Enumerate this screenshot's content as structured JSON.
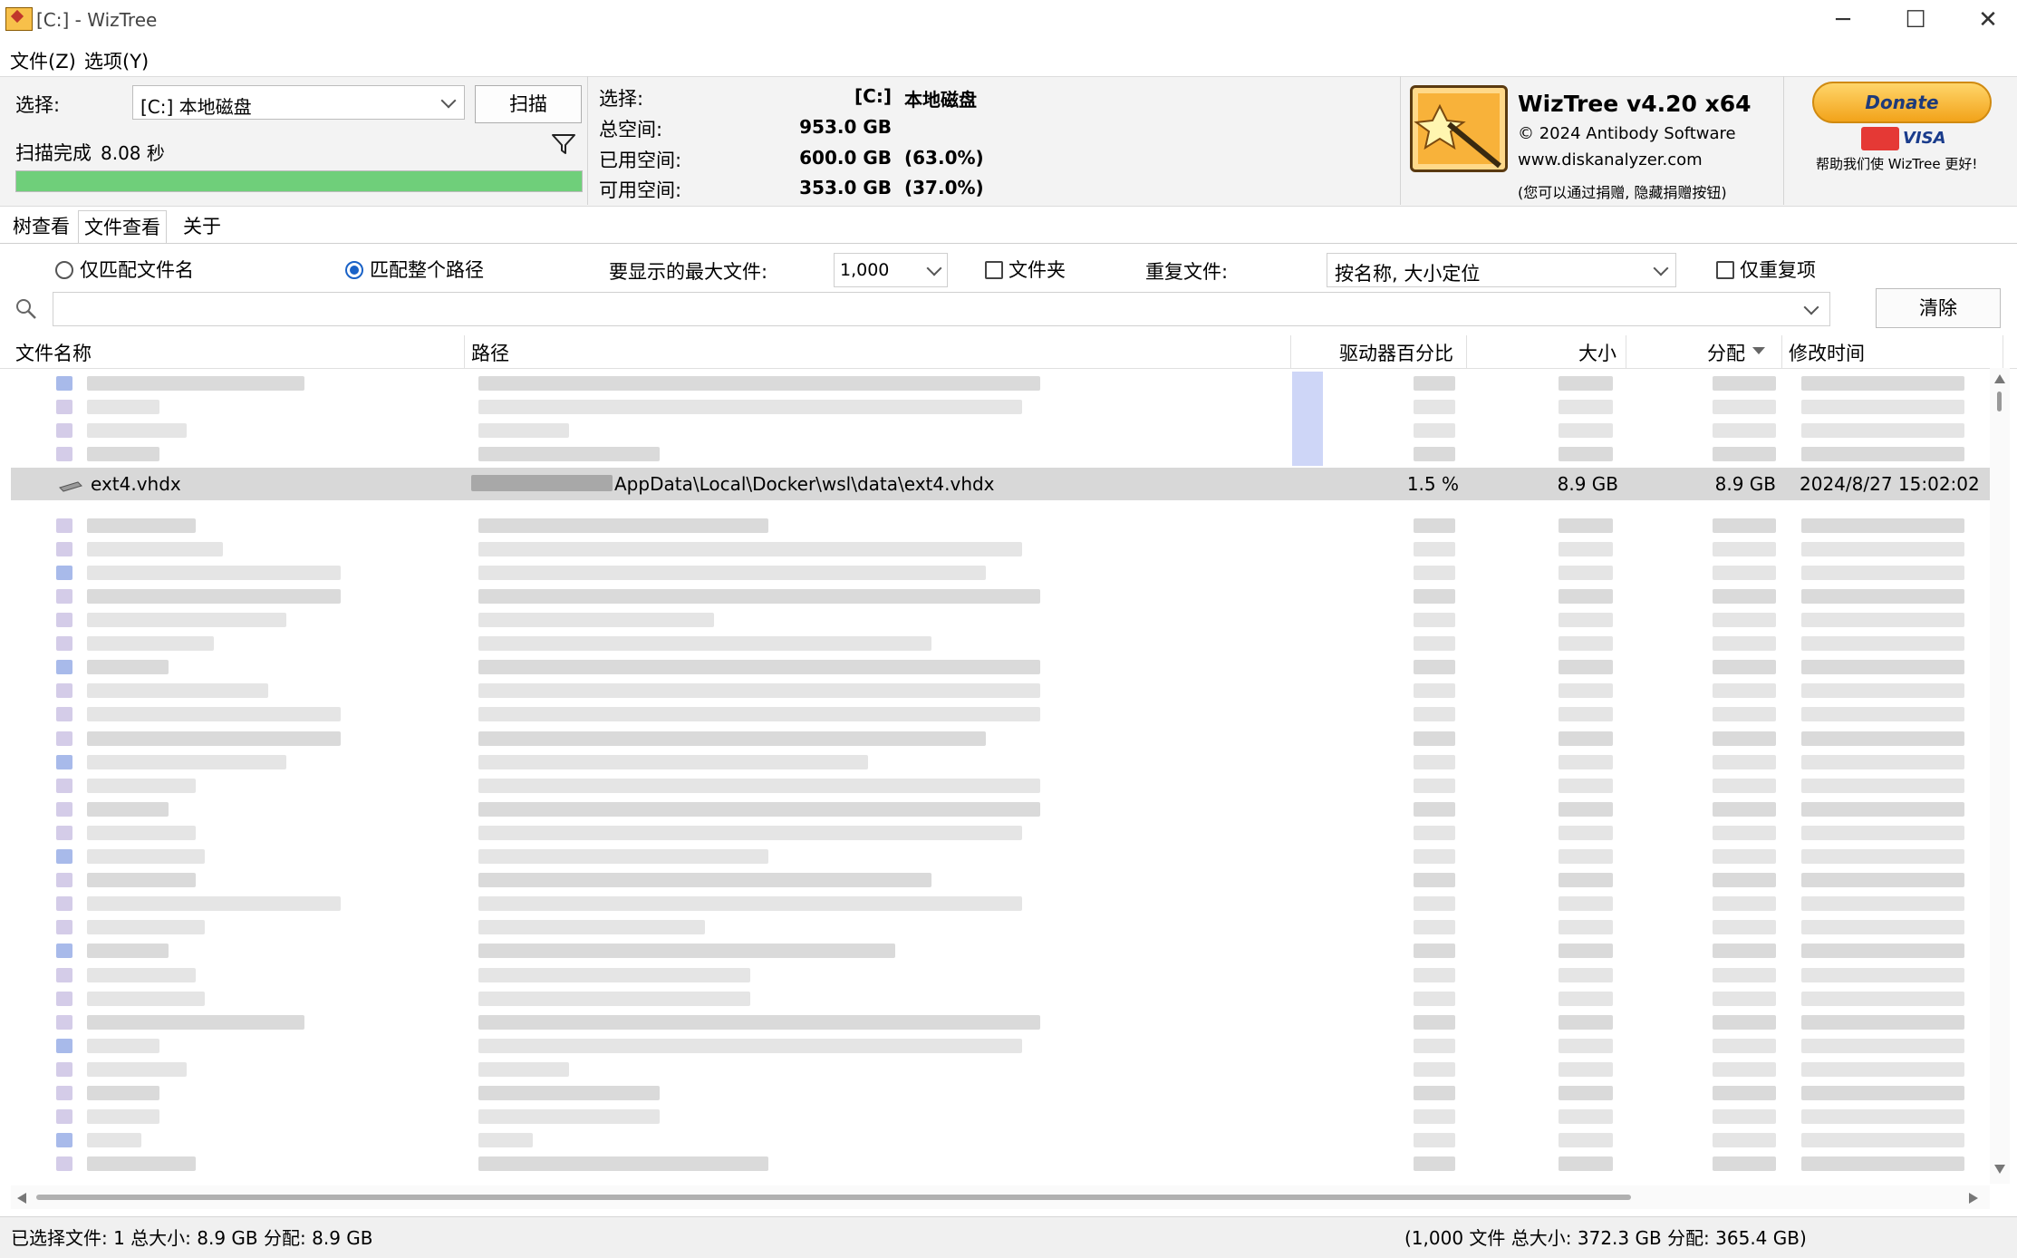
{
  "window": {
    "title": "[C:]  - WizTree",
    "minimize": "─",
    "maximize": "☐",
    "close": "✕"
  },
  "menu": [
    "文件(Z)",
    "选项(Y)"
  ],
  "scan": {
    "select_label": "选择:",
    "drive_value": "[C:] 本地磁盘",
    "scan_button": "扫描",
    "status_label": "扫描完成",
    "status_time": "8.08 秒",
    "progress": 1.0
  },
  "disk_info": {
    "select_label": "选择:",
    "select_drive": "[C:]",
    "select_name": "本地磁盘",
    "total_label": "总空间:",
    "total_value": "953.0 GB",
    "used_label": "已用空间:",
    "used_value": "600.0 GB",
    "used_pct": "(63.0%)",
    "free_label": "可用空间:",
    "free_value": "353.0 GB",
    "free_pct": "(37.0%)"
  },
  "about": {
    "product": "WizTree v4.20 x64",
    "copyright": "© 2024 Antibody Software",
    "website": "www.diskanalyzer.com",
    "note": "(您可以通过捐赠, 隐藏捐赠按钮)",
    "donate": "Donate",
    "visa": "VISA",
    "help": "帮助我们使 WizTree 更好!"
  },
  "tabs": [
    "树查看",
    "文件查看",
    "关于"
  ],
  "active_tab": "文件查看",
  "filters": {
    "match_name": "仅匹配文件名",
    "match_path": "匹配整个路径",
    "max_files_label": "要显示的最大文件:",
    "max_files_value": "1,000",
    "folders_label": "文件夹",
    "dup_label": "重复文件:",
    "dup_value": "按名称, 大小定位",
    "dup_only_label": "仅重复项",
    "clear_button": "清除"
  },
  "columns": [
    "文件名称",
    "路径",
    "驱动器百分比",
    "大小",
    "分配",
    "修改时间"
  ],
  "selected_row": {
    "name": "ext4.vhdx",
    "path": "AppData\\Local\\Docker\\wsl\\data\\ext4.vhdx",
    "percent": "1.5 %",
    "size": "8.9 GB",
    "allocated": "8.9 GB",
    "modified": "2024/8/27 15:02:02"
  },
  "status": {
    "left": "已选择文件: 1  总大小: 8.9 GB  分配: 8.9 GB",
    "right": "(1,000 文件  总大小: 372.3 GB  分配: 365.4 GB)"
  },
  "colors": {
    "progress": "#6fcf7a",
    "selected_row": "#d8d8d8",
    "accent": "#1a62c7"
  }
}
